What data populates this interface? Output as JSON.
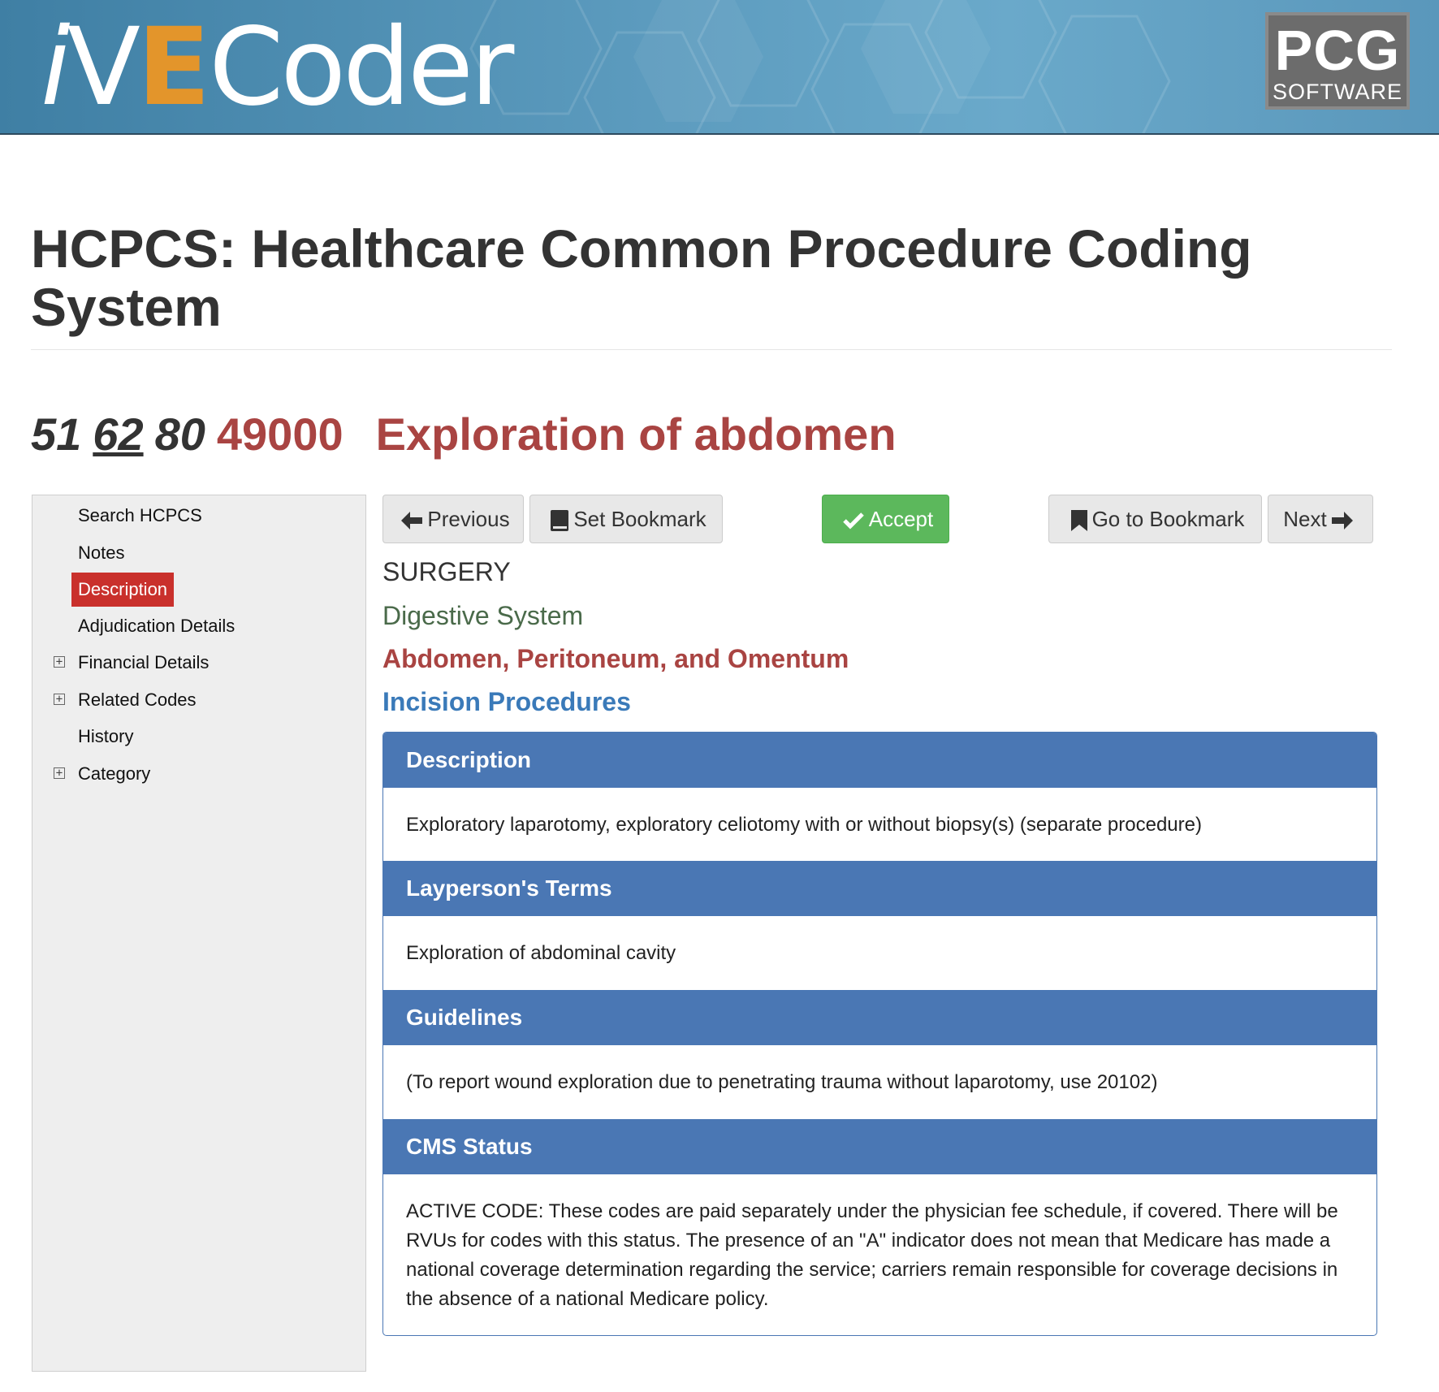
{
  "header": {
    "logo": {
      "i": "i",
      "v": "V",
      "e": "E",
      "rest": "Coder",
      "reg": "®"
    },
    "vendor_logo": {
      "line1": "PCG",
      "line2": "SOFTWARE"
    },
    "colors": {
      "banner": "#4f8fb4",
      "logo_accent": "#e3952b"
    }
  },
  "page": {
    "title": "HCPCS: Healthcare Common Procedure Coding System"
  },
  "code": {
    "modifiers": [
      "51",
      "62",
      "80"
    ],
    "code": "49000",
    "name": "Exploration of abdomen",
    "color": "#a94442"
  },
  "sidebar": {
    "items": [
      {
        "label": "Search HCPCS",
        "expandable": false,
        "active": false
      },
      {
        "label": "Notes",
        "expandable": false,
        "active": false
      },
      {
        "label": "Description",
        "expandable": false,
        "active": true
      },
      {
        "label": "Adjudication Details",
        "expandable": false,
        "active": false
      },
      {
        "label": "Financial Details",
        "expandable": true,
        "active": false
      },
      {
        "label": "Related Codes",
        "expandable": true,
        "active": false
      },
      {
        "label": "History",
        "expandable": false,
        "active": false
      },
      {
        "label": "Category",
        "expandable": true,
        "active": false
      }
    ],
    "expand_glyph": "+"
  },
  "toolbar": {
    "previous": "Previous",
    "set_bookmark": "Set Bookmark",
    "accept": "Accept",
    "go_to_bookmark": "Go to Bookmark",
    "next": "Next"
  },
  "hierarchy": {
    "section": "SURGERY",
    "system": "Digestive System",
    "subsystem": "Abdomen, Peritoneum, and Omentum",
    "procedure_type": "Incision Procedures"
  },
  "panels": [
    {
      "title": "Description",
      "body": "Exploratory laparotomy, exploratory celiotomy with or without biopsy(s) (separate procedure)"
    },
    {
      "title": "Layperson's Terms",
      "body": "Exploration of abdominal cavity"
    },
    {
      "title": "Guidelines",
      "body": "(To report wound exploration due to penetrating trauma without laparotomy, use 20102)"
    },
    {
      "title": "CMS Status",
      "body": "ACTIVE CODE: These codes are paid separately under the physician fee schedule, if covered. There will be RVUs for codes with this status. The presence of an \"A\" indicator does not mean that Medicare has made a national coverage determination regarding the service; carriers remain responsible for coverage decisions in the absence of a national Medicare policy."
    }
  ]
}
